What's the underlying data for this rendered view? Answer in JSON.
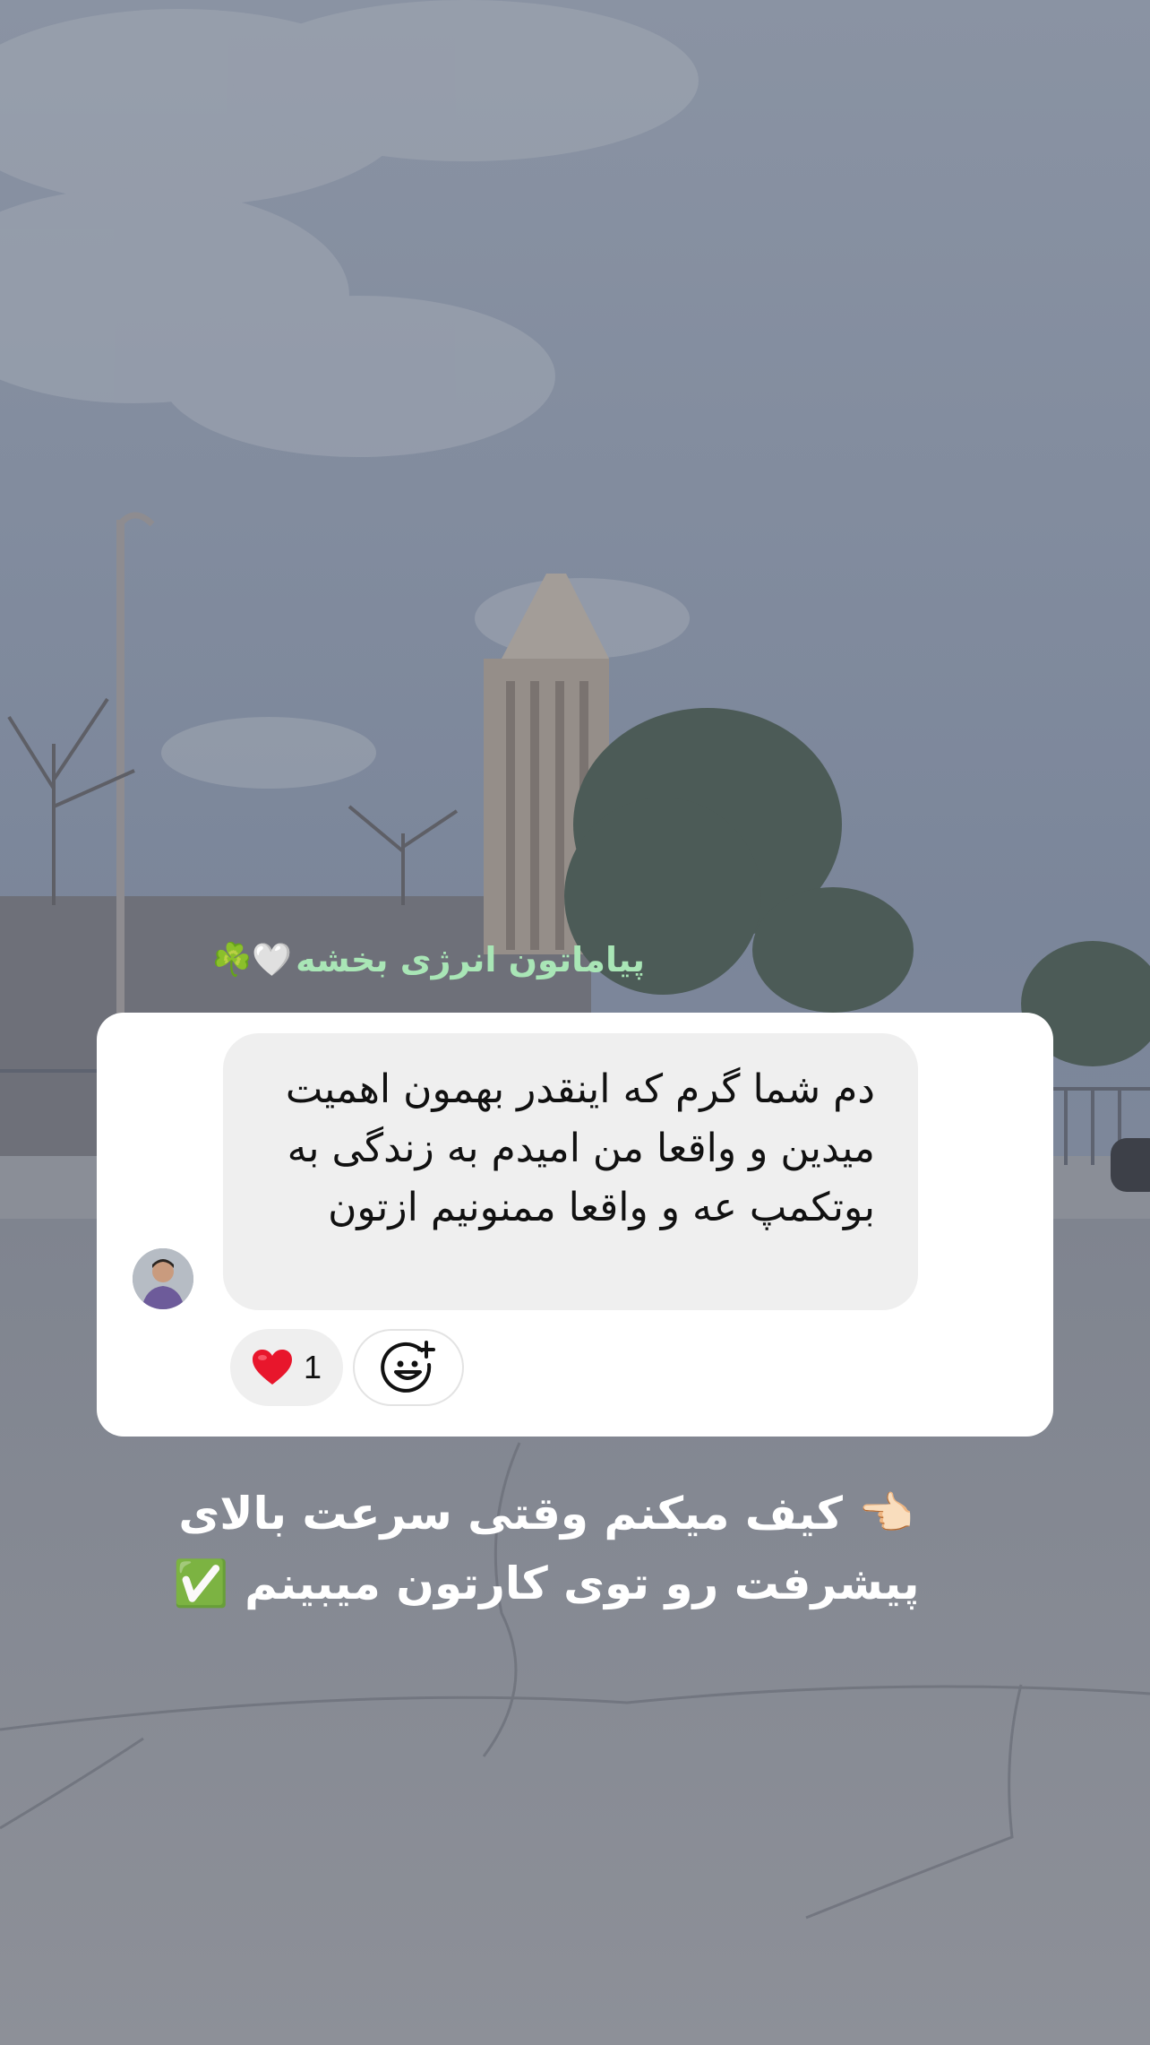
{
  "story": {
    "title_text": "پیاماتون انرژی بخشه",
    "title_emojis": "🤍☘️",
    "caption_line1": "👈🏻 کیف میکنم وقتی سرعت بالای",
    "caption_line2": "پیشرفت رو توی کارتون میبینم ✅"
  },
  "message": {
    "text": "دم شما گرم که اینقدر بهمون اهمیت میدین و واقعا من امیدم به زندگی به بوتکمپ عه و واقعا ممنونیم ازتون",
    "reaction_emoji": "❤️",
    "reaction_count": "1",
    "add_reaction_icon": "smiley-plus-icon"
  },
  "colors": {
    "title_green": "#a9e6b6",
    "card_bg": "#ffffff",
    "bubble_bg": "#efefef",
    "heart_red": "#e8162c"
  }
}
